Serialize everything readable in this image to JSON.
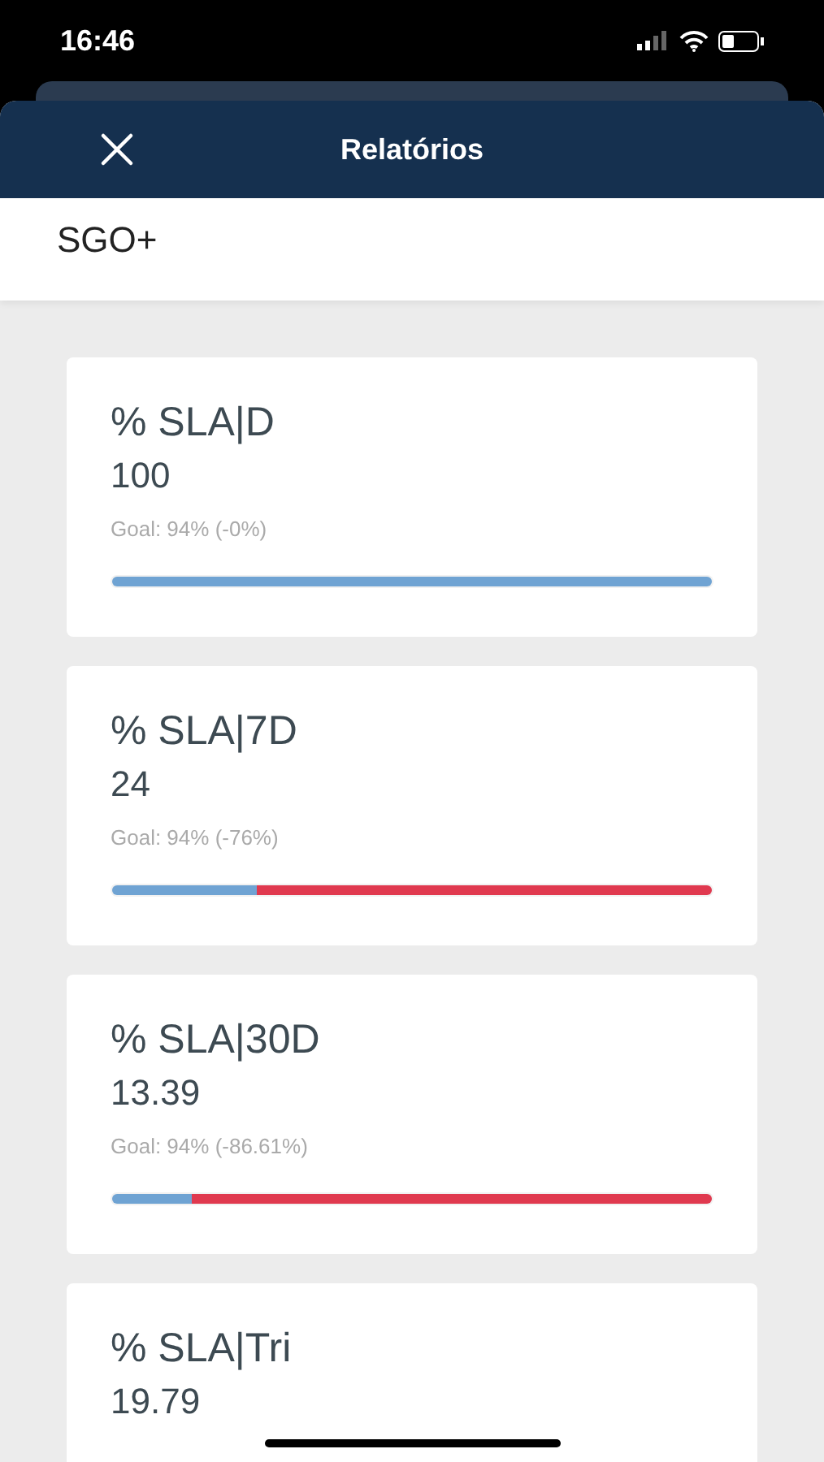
{
  "status_bar": {
    "time": "16:46"
  },
  "header": {
    "title": "Relatórios"
  },
  "section": {
    "title": "SGO+"
  },
  "cards": [
    {
      "title": "% SLA|D",
      "value": "100",
      "goal": "Goal: 94% (-0%)",
      "level": 1
    },
    {
      "title": "% SLA|7D",
      "value": "24",
      "goal": "Goal: 94% (-76%)",
      "level": 0.24
    },
    {
      "title": "% SLA|30D",
      "value": "13.39",
      "goal": "Goal: 94% (-86.61%)",
      "level": 0.1339
    },
    {
      "title": "% SLA|Tri",
      "value": "19.79"
    }
  ]
}
